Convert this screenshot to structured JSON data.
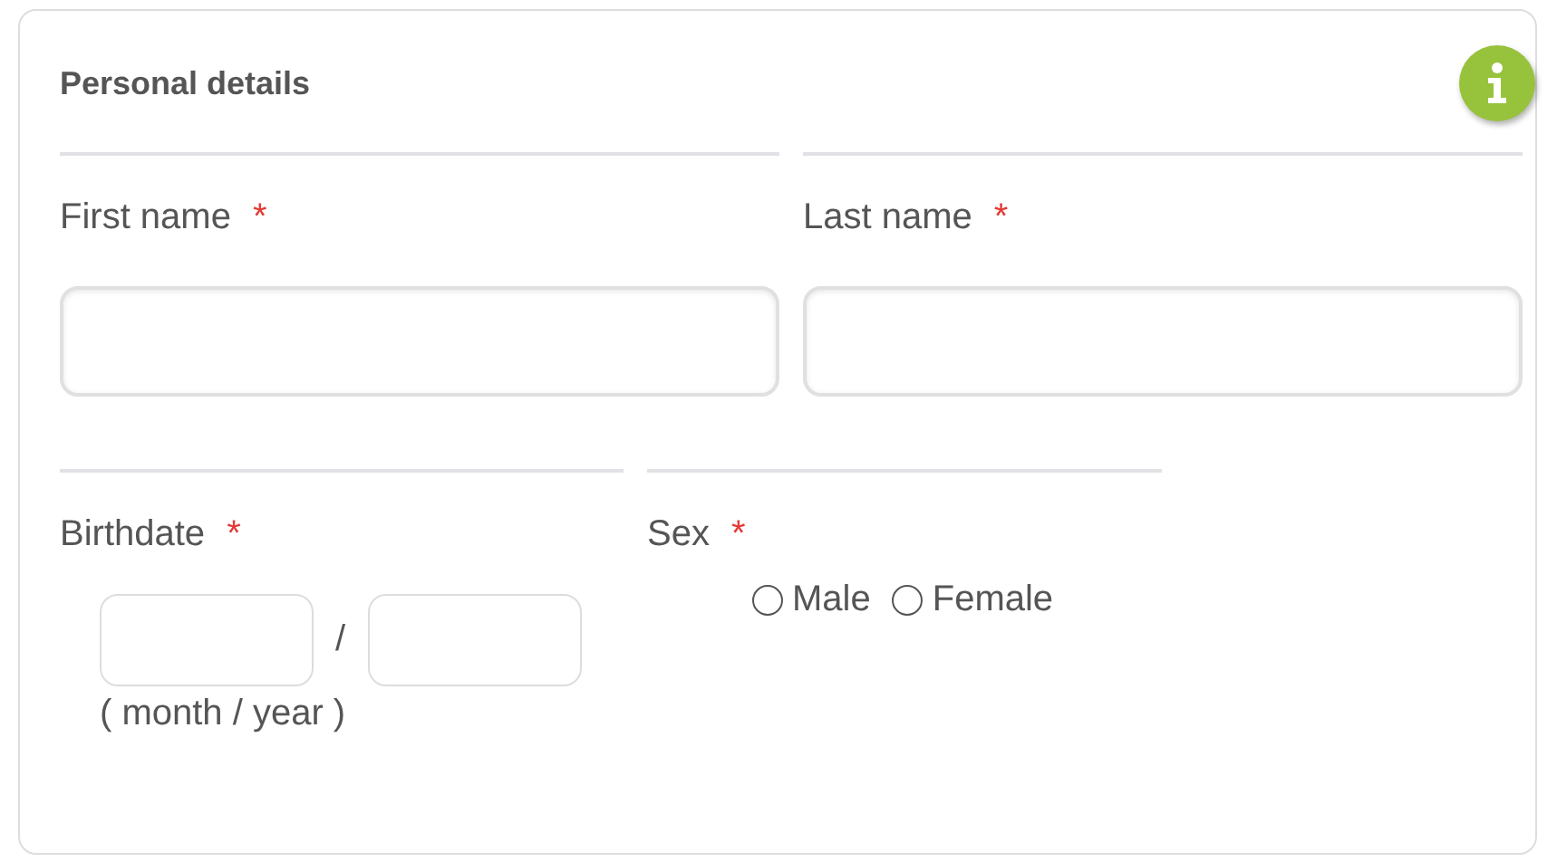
{
  "section": {
    "title": "Personal details"
  },
  "rows": [
    {
      "fields": [
        {
          "kind": "text",
          "label": "First name",
          "required_mark": "*"
        },
        {
          "kind": "text",
          "label": "Last name",
          "required_mark": "*"
        }
      ]
    },
    {
      "fields": [
        {
          "kind": "date",
          "label": "Birthdate",
          "required_mark": "*",
          "separator": "/",
          "hint": "( month / year )"
        },
        {
          "kind": "radio",
          "label": "Sex",
          "required_mark": "*",
          "options": [
            {
              "label": "Male",
              "selected": false
            },
            {
              "label": "Female",
              "selected": false
            }
          ]
        }
      ]
    }
  ]
}
